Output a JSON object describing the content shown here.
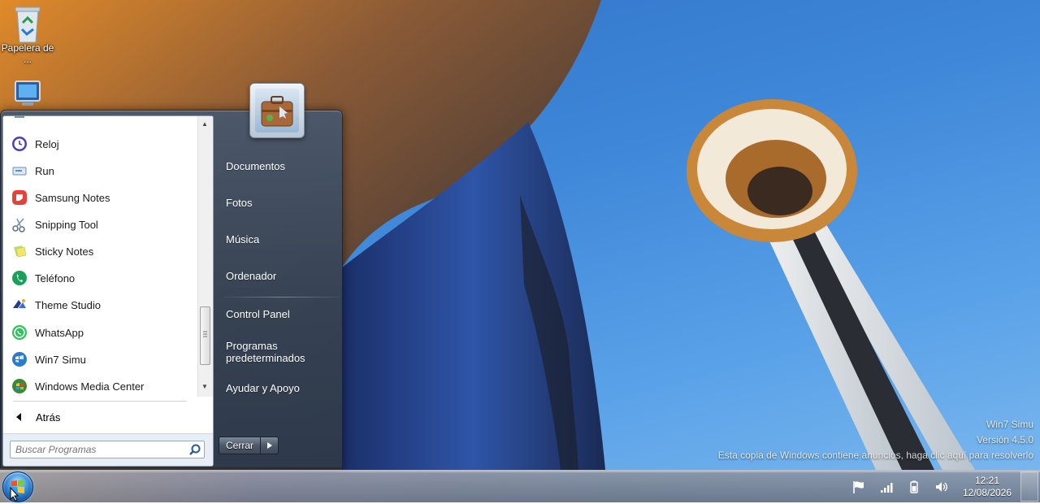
{
  "desktop": {
    "icons": [
      {
        "label": "Papelera de ...",
        "icon": "recycle-bin-icon"
      },
      {
        "label": "",
        "icon": "computer-icon"
      }
    ],
    "watermark": {
      "line1": "Win7 Simu",
      "line2": "Versión 4.5.0",
      "line3": "Esta copia de Windows contiene anuncios, haga clic aquí para resolverlo"
    }
  },
  "start_menu": {
    "programs": [
      {
        "label": "Reloj",
        "icon": "clock-icon"
      },
      {
        "label": "Run",
        "icon": "run-icon"
      },
      {
        "label": "Samsung Notes",
        "icon": "samsung-notes-icon"
      },
      {
        "label": "Snipping Tool",
        "icon": "scissors-icon"
      },
      {
        "label": "Sticky Notes",
        "icon": "sticky-notes-icon"
      },
      {
        "label": "Teléfono",
        "icon": "phone-icon"
      },
      {
        "label": "Theme Studio",
        "icon": "theme-studio-icon"
      },
      {
        "label": "WhatsApp",
        "icon": "whatsapp-icon"
      },
      {
        "label": "Win7 Simu",
        "icon": "win7-simu-icon"
      },
      {
        "label": "Windows Media Center",
        "icon": "media-center-icon"
      }
    ],
    "back_label": "Atrás",
    "search_placeholder": "Buscar Programas",
    "right_links": [
      {
        "label": "Documentos"
      },
      {
        "label": "Fotos"
      },
      {
        "label": "Música"
      },
      {
        "label": "Ordenador"
      },
      {
        "label": "Control Panel"
      },
      {
        "label": "Programas\npredeterminados"
      },
      {
        "label": "Ayudar y Apoyo"
      }
    ],
    "shutdown_label": "Cerrar"
  },
  "taskbar": {
    "clock_time": "12:21",
    "clock_date": "12/08/2026"
  },
  "colors": {
    "start_menu_bg": "#3e4e63",
    "orb_blue": "#1a5fb0",
    "sky": "#3d86d8"
  }
}
